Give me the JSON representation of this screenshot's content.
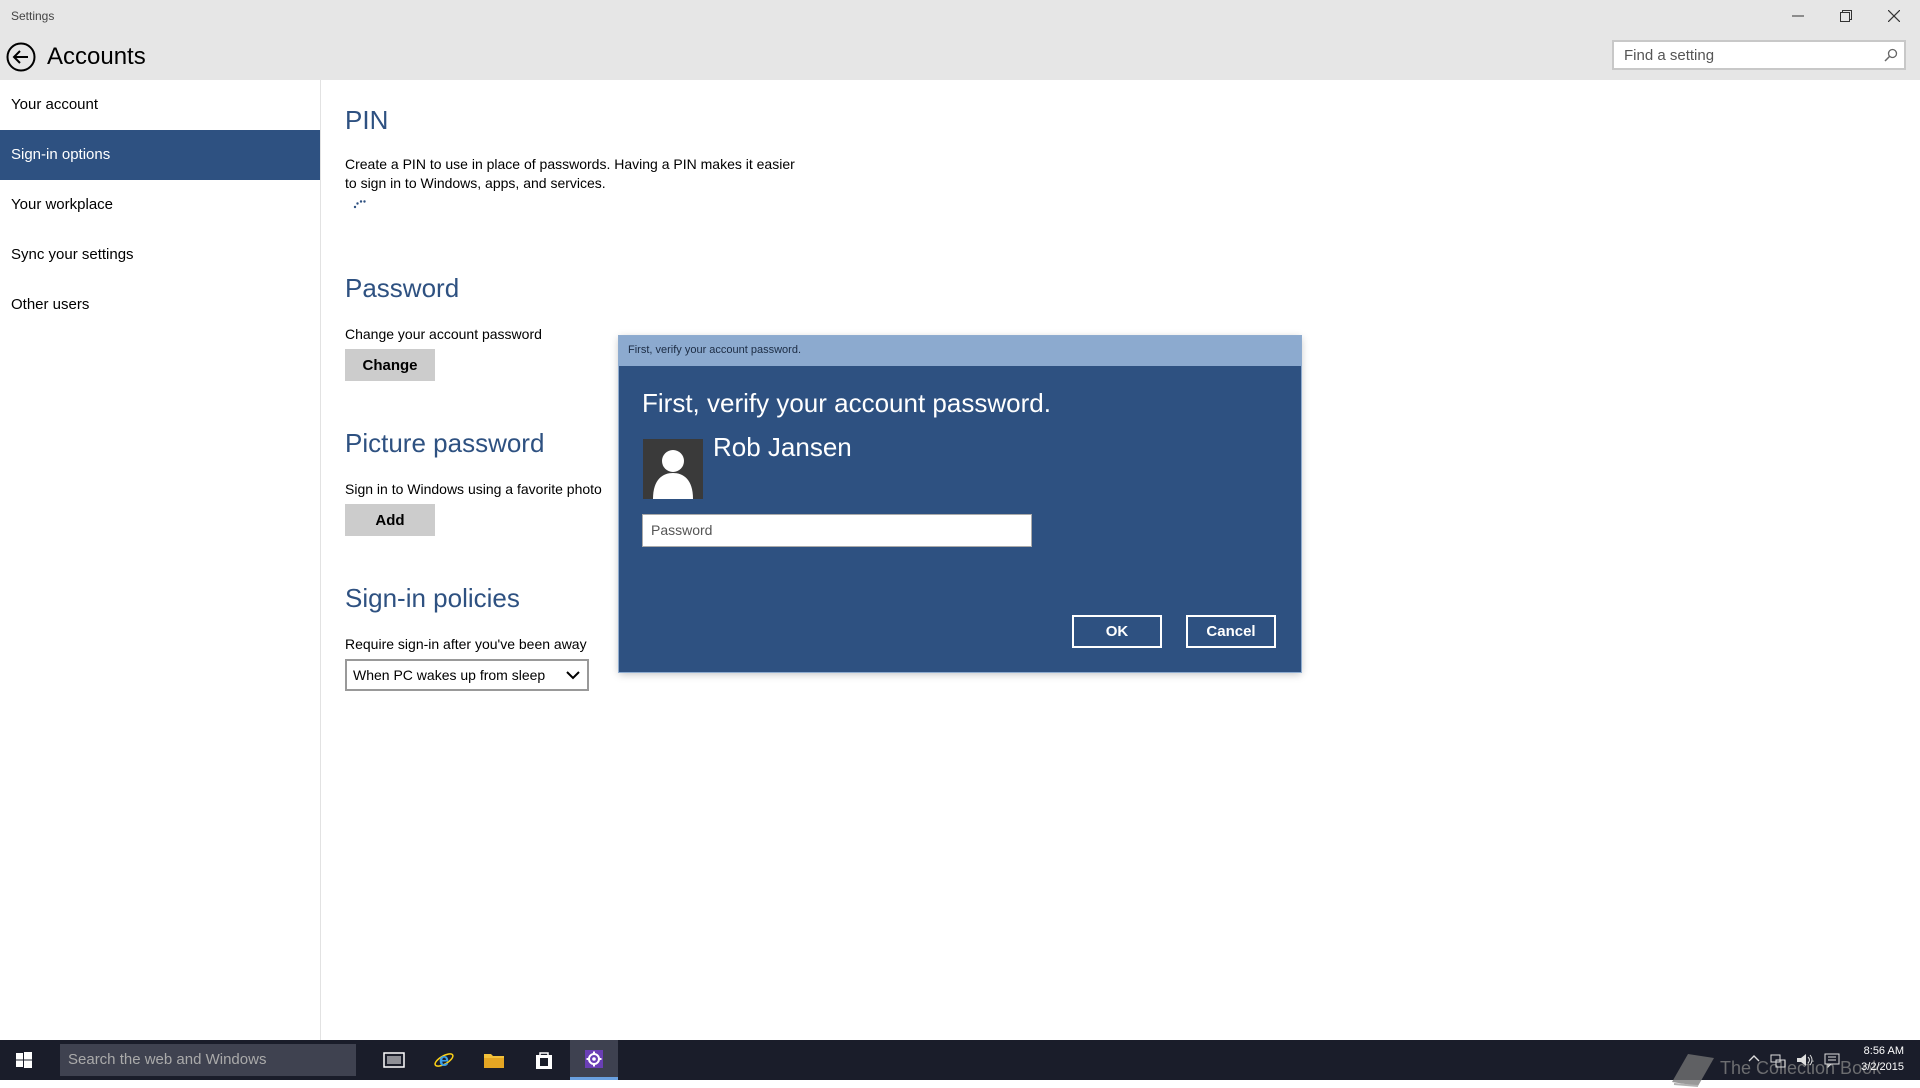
{
  "window": {
    "title": "Settings",
    "icons": {
      "minimize": "minimize-icon",
      "maximize": "restore-icon",
      "close": "close-icon"
    }
  },
  "header": {
    "title": "Accounts",
    "back_icon": "back-arrow-icon",
    "search_placeholder": "Find a setting",
    "search_icon": "search-icon"
  },
  "sidebar": {
    "items": [
      {
        "label": "Your account",
        "active": false
      },
      {
        "label": "Sign-in options",
        "active": true
      },
      {
        "label": "Your workplace",
        "active": false
      },
      {
        "label": "Sync your settings",
        "active": false
      },
      {
        "label": "Other users",
        "active": false
      }
    ]
  },
  "main": {
    "pin": {
      "title": "PIN",
      "description_line1": "Create a PIN to use in place of passwords. Having a PIN makes it easier",
      "description_line2": "to sign in to Windows, apps, and services."
    },
    "password": {
      "title": "Password",
      "description": "Change your account password",
      "button": "Change"
    },
    "picture_password": {
      "title": "Picture password",
      "description": "Sign in to Windows using a favorite photo",
      "button": "Add"
    },
    "signin_policies": {
      "title": "Sign-in policies",
      "description": "Require sign-in after you've been away",
      "selected": "When PC wakes up from sleep"
    }
  },
  "dialog": {
    "titlebar": "First, verify your account password.",
    "heading": "First, verify your account password.",
    "user_name": "Rob Jansen",
    "password_placeholder": "Password",
    "ok": "OK",
    "cancel": "Cancel"
  },
  "taskbar": {
    "search_text": "Search the web and Windows",
    "watermark": "The Collection Book",
    "time": "8:56 AM",
    "date": "3/2/2015",
    "accent": "#2e5181"
  }
}
